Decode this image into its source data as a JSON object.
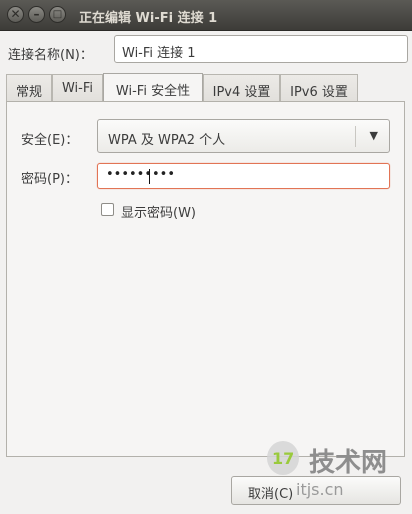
{
  "window": {
    "title": "正在编辑 Wi-Fi 连接 1",
    "close_glyph": "✕",
    "minimize_glyph": "–",
    "maximize_glyph": "□"
  },
  "connection": {
    "label": "连接名称(N)：",
    "value": "Wi-Fi 连接 1"
  },
  "tabs": [
    {
      "label": "常规",
      "active": false
    },
    {
      "label": "Wi-Fi",
      "active": false
    },
    {
      "label": "Wi-Fi 安全性",
      "active": true
    },
    {
      "label": "IPv4 设置",
      "active": false
    },
    {
      "label": "IPv6 设置",
      "active": false
    }
  ],
  "security": {
    "label": "安全(E)：",
    "selected": "WPA 及 WPA2 个人",
    "dropdown_icon": "triangle-down-icon"
  },
  "password": {
    "label": "密码(P)：",
    "masked_value": "•••••••••"
  },
  "show_password": {
    "label": "显示密码(W)",
    "checked": false
  },
  "buttons": {
    "cancel": "取消(C)"
  },
  "watermark": {
    "badge": "17",
    "text": "技术网",
    "url": "itjs.cn"
  },
  "colors": {
    "titlebar": "#3d3c38",
    "focus_border": "#e27455",
    "watermark": "#8e8e8e"
  }
}
